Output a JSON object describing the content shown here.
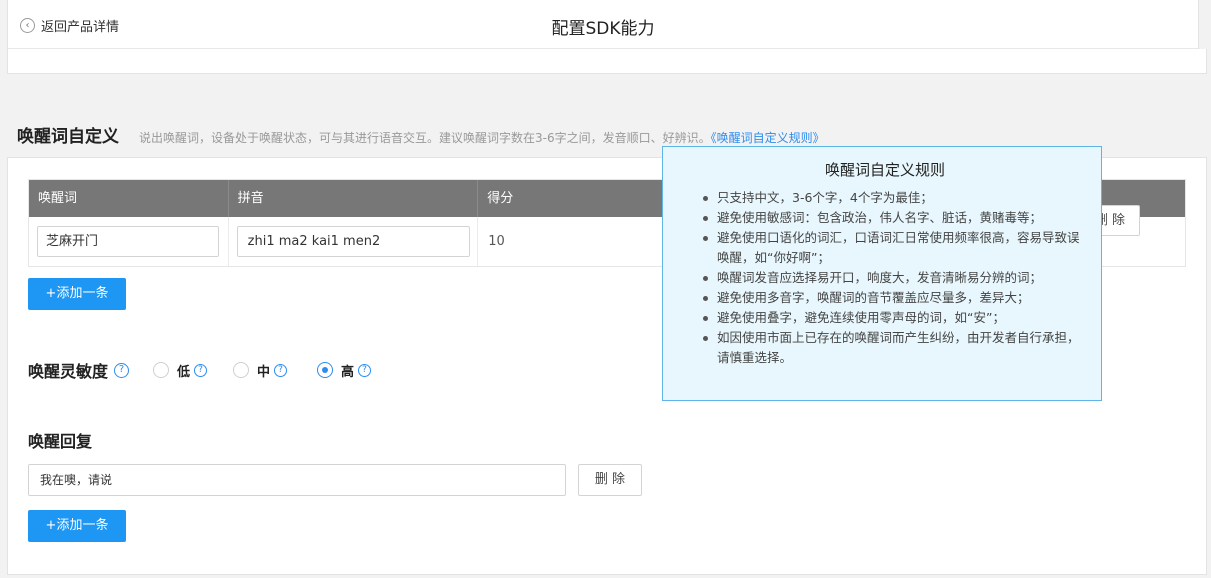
{
  "header": {
    "back_label": "返回产品详情",
    "title": "配置SDK能力"
  },
  "wake_section": {
    "title": "唤醒词自定义",
    "description": "说出唤醒词，设备处于唤醒状态，可与其进行语音交互。建议唤醒词字数在3-6字之间，发音顺口、好辨识。",
    "rules_link": "《唤醒词自定义规则》"
  },
  "table": {
    "columns": [
      "唤醒词",
      "拼音",
      "得分"
    ],
    "rows": [
      {
        "word": "芝麻开门",
        "pinyin": "zhi1 ma2 kai1 men2",
        "score": "10"
      }
    ],
    "delete_label": "删 除",
    "add_label": "+添加一条"
  },
  "sensitivity": {
    "title": "唤醒灵敏度",
    "options": [
      "低",
      "中",
      "高"
    ],
    "selected": "高",
    "help_icon": "question-circle-icon"
  },
  "reply": {
    "title": "唤醒回复",
    "value": "我在噢，请说",
    "delete_label": "删 除",
    "add_label": "+添加一条"
  },
  "popover": {
    "title": "唤醒词自定义规则",
    "items": [
      "只支持中文，3-6个字，4个字为最佳；",
      "避免使用敏感词：包含政治，伟人名字、脏话，黄赌毒等；",
      "避免使用口语化的词汇，口语词汇日常使用频率很高，容易导致误唤醒，如“你好啊”；",
      "唤醒词发音应选择易开口，响度大，发音清晰易分辨的词；",
      "避免使用多音字，唤醒词的音节覆盖应尽量多，差异大；",
      "避免使用叠字，避免连续使用零声母的词，如“安”；",
      "如因使用市面上已存在的唤醒词而产生纠纷，由开发者自行承担，请慎重选择。"
    ]
  },
  "colors": {
    "primary": "#1e96f3",
    "link": "#2d8cf0",
    "table_header": "#777777",
    "popover_bg": "#e8f7fd"
  }
}
